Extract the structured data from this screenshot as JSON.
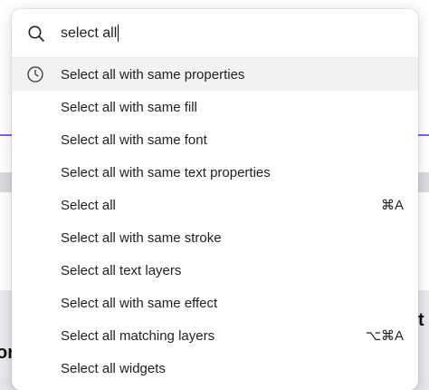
{
  "search": {
    "query": "select all"
  },
  "results": [
    {
      "label": "Select all with same properties",
      "shortcut": "",
      "recent": true
    },
    {
      "label": "Select all with same fill",
      "shortcut": ""
    },
    {
      "label": "Select all with same font",
      "shortcut": ""
    },
    {
      "label": "Select all with same text properties",
      "shortcut": ""
    },
    {
      "label": "Select all",
      "shortcut": "⌘A"
    },
    {
      "label": "Select all with same stroke",
      "shortcut": ""
    },
    {
      "label": "Select all text layers",
      "shortcut": ""
    },
    {
      "label": "Select all with same effect",
      "shortcut": ""
    },
    {
      "label": "Select all matching layers",
      "shortcut": "⌥⌘A"
    },
    {
      "label": "Select all widgets",
      "shortcut": ""
    }
  ],
  "background": {
    "left_glyph": "or",
    "right_glyph": "t"
  },
  "colors": {
    "accent": "#8b5cf6",
    "highlight": "#f2f2f2",
    "text": "#1f1f1f"
  }
}
